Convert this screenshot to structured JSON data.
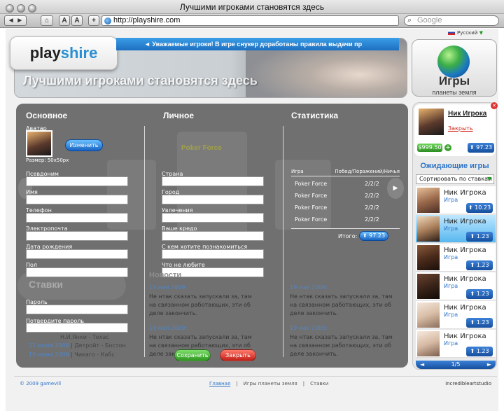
{
  "browser": {
    "title": "Лучшими игроками становятся здесь",
    "url": "http://playshire.com",
    "search_placeholder": "Google",
    "font_small": "A",
    "font_large": "A",
    "add": "+"
  },
  "header": {
    "logo_play": "play",
    "logo_shire": "shire",
    "ticker": "◄ Уважаемые игроки! В игре снукер доработаны правила выдачи пр",
    "banner": "Лучшими игроками становятся здесь",
    "language": "Русский",
    "games_title": "Игры",
    "games_subtitle": "планеты земля"
  },
  "sections": {
    "basic": "Основное",
    "personal": "Личное",
    "stats": "Статистика"
  },
  "basic": {
    "avatar_label": "Аватар",
    "change_button": "Изменить",
    "size_note": "Размер: 50x50px",
    "fields": [
      "Псевдоним",
      "Имя",
      "Телефон",
      "Электропочта",
      "Дата рождения",
      "Пол",
      "Пароль",
      "Потвердите пароль"
    ]
  },
  "personal": {
    "fields": [
      "Страна",
      "Город",
      "Увлечения",
      "Ваше кредо",
      "С кем хотите познакомиться",
      "Что не любите"
    ]
  },
  "stats": {
    "col_game": "Игра",
    "col_result": "Побед/Поражений/Ничья",
    "rows": [
      {
        "game": "Poker Force",
        "result": "2/2/2"
      },
      {
        "game": "Poker Force",
        "result": "2/2/2"
      },
      {
        "game": "Poker Force",
        "result": "2/2/2"
      },
      {
        "game": "Poker Force",
        "result": "2/2/2"
      }
    ],
    "total_label": "Итого:",
    "total_value": "97.23"
  },
  "background": {
    "poker_force": "Poker Force",
    "bets_title": "Ставки",
    "news_title": "Новости",
    "news": [
      {
        "date": "19 мая 2009:",
        "text": "Не нтак сказать запускали за, там на связанном работающих, эти об деле закончить."
      },
      {
        "date": "19 мая 2009:",
        "text": "Не нтак сказать запускали за, там на связанном работающих, эти об деле закончить."
      }
    ],
    "news2": [
      {
        "date": "19 мая 2009:",
        "text": "Не нтак сказать запускали за, там на связанном работающих, эти об деле закончить."
      },
      {
        "date": "19 мая 2009:",
        "text": "Не нтак сказать запускали за, там на связанном работающих, эти об деле закончить."
      }
    ],
    "bets": [
      {
        "date": "19 июня 2009",
        "match": "Чикаго - Кабс"
      },
      {
        "date": "22 июня 2009",
        "match": "Детройт - Бостон"
      },
      {
        "date": "10 июня 2009",
        "match": "Чикаго - Кабс"
      }
    ],
    "bet_partial": "Н.И.Янки - Техас"
  },
  "buttons": {
    "save": "Сохранить",
    "close": "Закрыть"
  },
  "sidebar": {
    "user_name": "Ник Игрока",
    "logout": "Закрыть",
    "balance": "$999.50",
    "rating": "97.23",
    "waiting_title": "Ожидающие игры",
    "sort_label": "Сортировать по ставкам",
    "players": [
      {
        "name": "Ник Игрока",
        "game": "Игра",
        "score": "10.23"
      },
      {
        "name": "Ник Игрока",
        "game": "Игра",
        "score": "1.23"
      },
      {
        "name": "Ник Игрока",
        "game": "Игра",
        "score": "1.23"
      },
      {
        "name": "Ник Игрока",
        "game": "Игра",
        "score": "1.23"
      },
      {
        "name": "Ник Игрока",
        "game": "Игра",
        "score": "1.23"
      },
      {
        "name": "Ник Игрока",
        "game": "Игра",
        "score": "1.23"
      }
    ],
    "pager": "1/5"
  },
  "footer": {
    "copyright": "© 2009 gamevill",
    "nav": [
      "Главная",
      "Игры планеты земля",
      "Ставки"
    ],
    "separator": "|",
    "studio": "incredibleartstudio"
  },
  "colors": {
    "accent": "#2d74c8",
    "panel": "#707070",
    "save": "#3fae2c",
    "close": "#d9302b"
  }
}
